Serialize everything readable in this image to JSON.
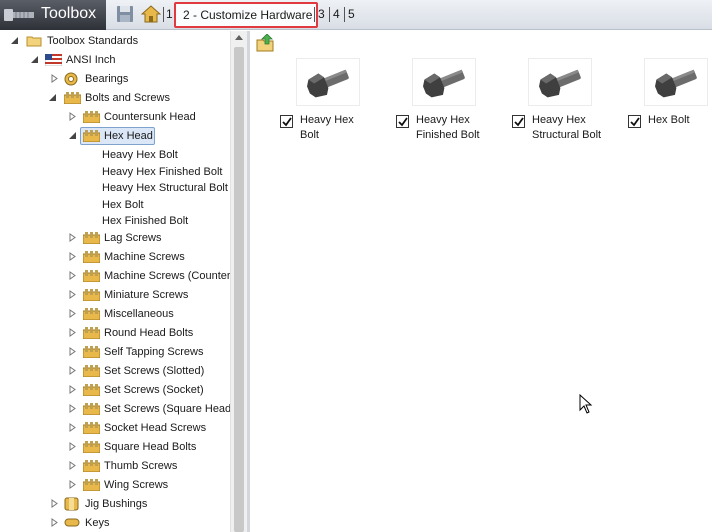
{
  "toolbar": {
    "title": "Toolbox",
    "steps": [
      "1",
      "2 - Customize Hardware",
      "3",
      "4",
      "5"
    ]
  },
  "tree": {
    "root": "Toolbox Standards",
    "standard": "ANSI Inch",
    "bearings": "Bearings",
    "bolts_and_screws": "Bolts and Screws",
    "countersunk_head": "Countersunk Head",
    "hex_head": "Hex Head",
    "hex_head_items": [
      "Heavy Hex Bolt",
      "Heavy Hex Finished Bolt",
      "Heavy Hex Structural Bolt",
      "Hex Bolt",
      "Hex Finished Bolt"
    ],
    "categories": [
      "Lag Screws",
      "Machine Screws",
      "Machine Screws (Counter",
      "Miniature Screws",
      "Miscellaneous",
      "Round Head Bolts",
      "Self Tapping Screws",
      "Set Screws (Slotted)",
      "Set Screws (Socket)",
      "Set Screws (Square Head)",
      "Socket Head Screws",
      "Square Head Bolts",
      "Thumb Screws",
      "Wing Screws"
    ],
    "jig_bushings": "Jig Bushings",
    "keys": "Keys"
  },
  "parts": [
    {
      "line1": "Heavy Hex",
      "line2": "Bolt",
      "checked": true
    },
    {
      "line1": "Heavy Hex",
      "line2": "Finished Bolt",
      "checked": true
    },
    {
      "line1": "Heavy Hex",
      "line2": "Structural Bolt",
      "checked": true
    },
    {
      "line1": "Hex Bolt",
      "line2": "",
      "checked": true
    }
  ],
  "colors": {
    "highlight_border": "#e0393f",
    "selection_fill": "#dbe7f7",
    "folder_yellow": "#e8b84a"
  }
}
